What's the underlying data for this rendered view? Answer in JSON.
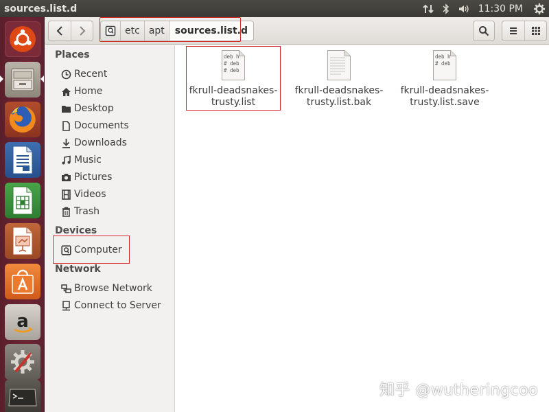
{
  "window": {
    "title": "sources.list.d"
  },
  "top_panel": {
    "clock": "11:30 PM"
  },
  "launcher": {
    "items": [
      {
        "icon": "ubuntu-dash-icon"
      },
      {
        "icon": "files-icon",
        "active": true
      },
      {
        "icon": "firefox-icon"
      },
      {
        "icon": "libreoffice-writer-icon"
      },
      {
        "icon": "libreoffice-calc-icon"
      },
      {
        "icon": "libreoffice-impress-icon"
      },
      {
        "icon": "software-center-icon"
      },
      {
        "icon": "amazon-icon"
      },
      {
        "icon": "system-settings-icon"
      },
      {
        "icon": "terminal-icon"
      }
    ]
  },
  "pathbar": {
    "segments": [
      "etc",
      "apt",
      "sources.list.d"
    ]
  },
  "sidebar": {
    "places_title": "Places",
    "places": [
      {
        "label": "Recent",
        "icon": "clock-icon"
      },
      {
        "label": "Home",
        "icon": "home-icon"
      },
      {
        "label": "Desktop",
        "icon": "folder-icon"
      },
      {
        "label": "Documents",
        "icon": "document-icon"
      },
      {
        "label": "Downloads",
        "icon": "download-icon"
      },
      {
        "label": "Music",
        "icon": "music-icon"
      },
      {
        "label": "Pictures",
        "icon": "camera-icon"
      },
      {
        "label": "Videos",
        "icon": "film-icon"
      },
      {
        "label": "Trash",
        "icon": "trash-icon"
      }
    ],
    "devices_title": "Devices",
    "devices": [
      {
        "label": "Computer",
        "icon": "computer-icon"
      }
    ],
    "network_title": "Network",
    "network": [
      {
        "label": "Browse Network",
        "icon": "network-icon"
      },
      {
        "label": "Connect to Server",
        "icon": "server-icon"
      }
    ]
  },
  "files": [
    {
      "name_line1": "fkrull-deadsnakes-",
      "name_line2": "trusty.list",
      "preview": [
        "deb h",
        "# deb",
        "# deb"
      ]
    },
    {
      "name_line1": "fkrull-deadsnakes-",
      "name_line2": "trusty.list.bak",
      "preview": []
    },
    {
      "name_line1": "fkrull-deadsnakes-",
      "name_line2": "trusty.list.save",
      "preview": [
        "deb h",
        "# deb"
      ]
    }
  ],
  "watermark": "知乎 @wutheringcoo",
  "colors": {
    "launcher": "#6d2433",
    "highlight": "#d9262b",
    "ubuntu_orange": "#dd4814"
  }
}
